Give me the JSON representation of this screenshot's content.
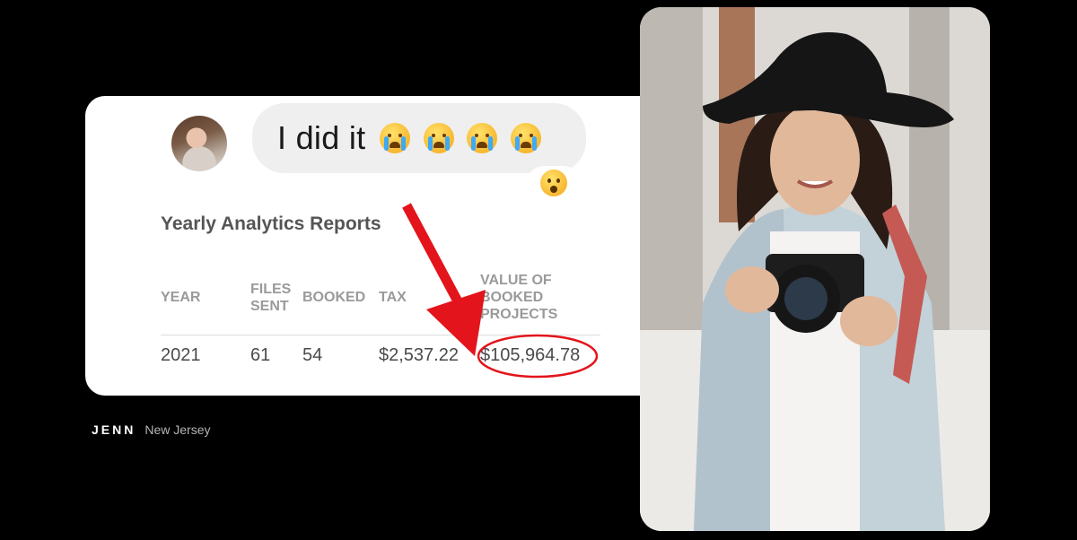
{
  "message": {
    "text": "I did it",
    "emoji_count": 4,
    "emoji_icon": "loudly-crying-face-icon",
    "reaction_icon": "astonished-face-icon"
  },
  "report": {
    "title": "Yearly Analytics Reports",
    "headers": {
      "year": "YEAR",
      "files_sent_1": "FILES",
      "files_sent_2": "SENT",
      "booked": "BOOKED",
      "tax": "TAX",
      "value_1": "VALUE OF",
      "value_2": "BOOKED",
      "value_3": "PROJECTS"
    },
    "row": {
      "year": "2021",
      "files_sent": "61",
      "booked": "54",
      "tax": "$2,537.22",
      "value": "$105,964.78"
    },
    "highlight_color": "#e3141b"
  },
  "footer": {
    "name": "JENN",
    "location": "New Jersey"
  }
}
